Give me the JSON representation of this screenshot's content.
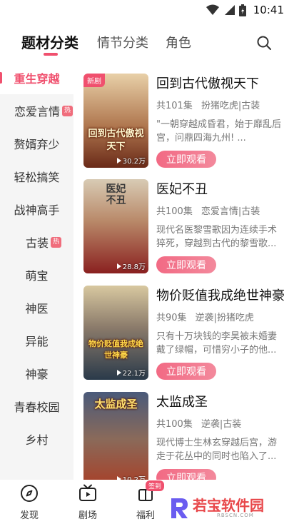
{
  "status_bar": {
    "time": "10:41",
    "icons": [
      "wifi-icon",
      "signal-icon",
      "battery-icon"
    ]
  },
  "header": {
    "tabs": [
      {
        "label": "题材分类",
        "active": true
      },
      {
        "label": "情节分类",
        "active": false
      },
      {
        "label": "角色",
        "active": false
      }
    ],
    "search_icon": "search-icon"
  },
  "sidebar": {
    "items": [
      {
        "label": "重生穿越",
        "active": true,
        "hot": false
      },
      {
        "label": "恋爱言情",
        "active": false,
        "hot": true
      },
      {
        "label": "赘婿弃少",
        "active": false,
        "hot": false
      },
      {
        "label": "轻松搞笑",
        "active": false,
        "hot": false
      },
      {
        "label": "战神高手",
        "active": false,
        "hot": false
      },
      {
        "label": "古装",
        "active": false,
        "hot": true
      },
      {
        "label": "萌宝",
        "active": false,
        "hot": false
      },
      {
        "label": "神医",
        "active": false,
        "hot": false
      },
      {
        "label": "异能",
        "active": false,
        "hot": false
      },
      {
        "label": "神豪",
        "active": false,
        "hot": false
      },
      {
        "label": "青春校园",
        "active": false,
        "hot": false
      },
      {
        "label": "乡村",
        "active": false,
        "hot": false
      }
    ],
    "hot_badge": "热"
  },
  "dramas": [
    {
      "title": "回到古代傲视天下",
      "episodes": "共101集",
      "tags": "扮猪吃虎|古装",
      "desc": "\"一朝穿越成昏君，始于靡乱后宫，问鼎四海九州! ...",
      "views": "30.2万",
      "poster_text": "回到古代傲视天下",
      "badge": "新剧",
      "poster_colors": [
        "#d9b88a",
        "#8a4a2a"
      ]
    },
    {
      "title": "医妃不丑",
      "episodes": "共100集",
      "tags": "恋爱言情|古装",
      "desc": "现代名医黎雪歌因为连续手术猝死，穿越到古代的黎雪歌...",
      "views": "28.8万",
      "poster_text": "医妃不丑",
      "badge": "",
      "poster_colors": [
        "#c8b8a0",
        "#9a2a2a"
      ]
    },
    {
      "title": "物价贬值我成绝世神豪",
      "episodes": "共90集",
      "tags": "逆袭|扮猪吃虎",
      "desc": "只有十万块钱的李昊被未婚妻戴了绿帽，可惜穷小子的他...",
      "views": "22.1万",
      "poster_text": "物价贬值我成绝世神豪",
      "badge": "",
      "poster_colors": [
        "#d8c090",
        "#3a4a5a"
      ]
    },
    {
      "title": "太监成圣",
      "episodes": "共100集",
      "tags": "逆袭|古装",
      "desc": "现代博士生林玄穿越后宫，游走于花丛中的同时也陷入了...",
      "views": "10.2万",
      "poster_text": "太监成圣",
      "badge": "",
      "poster_colors": [
        "#3a4a6a",
        "#b04a2a"
      ]
    }
  ],
  "watch_label": "立即观看",
  "bottom_nav": {
    "items": [
      {
        "label": "发现",
        "icon": "compass-icon"
      },
      {
        "label": "剧场",
        "icon": "tv-icon"
      },
      {
        "label": "福利",
        "icon": "gift-icon",
        "badge": "签到"
      }
    ]
  },
  "watermark": {
    "text": "若宝软件园",
    "url": "RBSCN.COM"
  },
  "colors": {
    "accent": "#f0506e",
    "sidebar_bg": "#f5f5f5"
  }
}
